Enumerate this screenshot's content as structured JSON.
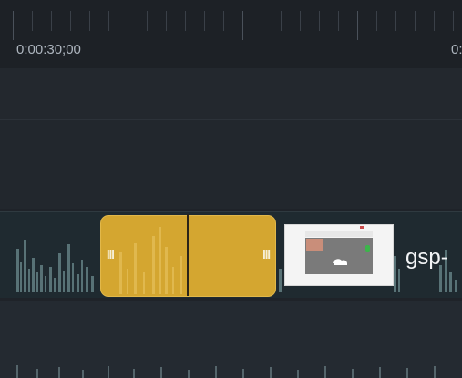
{
  "timeline": {
    "ruler_ticks": 24,
    "timecodes": [
      "0:00:30;00",
      "0:"
    ]
  },
  "tracks": {
    "video_clip": {
      "title": "gsp-",
      "color": "#d4a630",
      "handle_left": "III",
      "handle_right": "III"
    },
    "thumbnail_colors": {
      "window": "#f4f4f4",
      "screen": "#7a7a7a",
      "accent": "#c94b4b",
      "indicator": "#3bb54a"
    }
  }
}
